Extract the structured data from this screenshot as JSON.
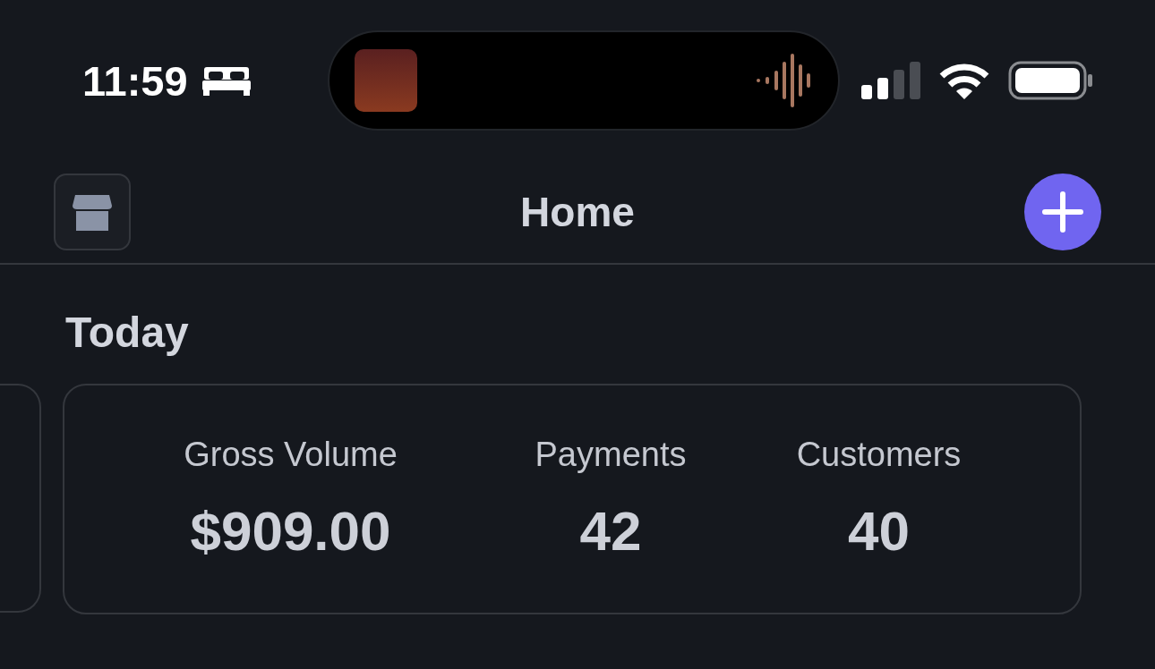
{
  "status_bar": {
    "time": "11:59"
  },
  "nav": {
    "title": "Home"
  },
  "section": {
    "title": "Today"
  },
  "stats": [
    {
      "label": "Gross Volume",
      "value": "$909.00"
    },
    {
      "label": "Payments",
      "value": "42"
    },
    {
      "label": "Customers",
      "value": "40"
    }
  ]
}
